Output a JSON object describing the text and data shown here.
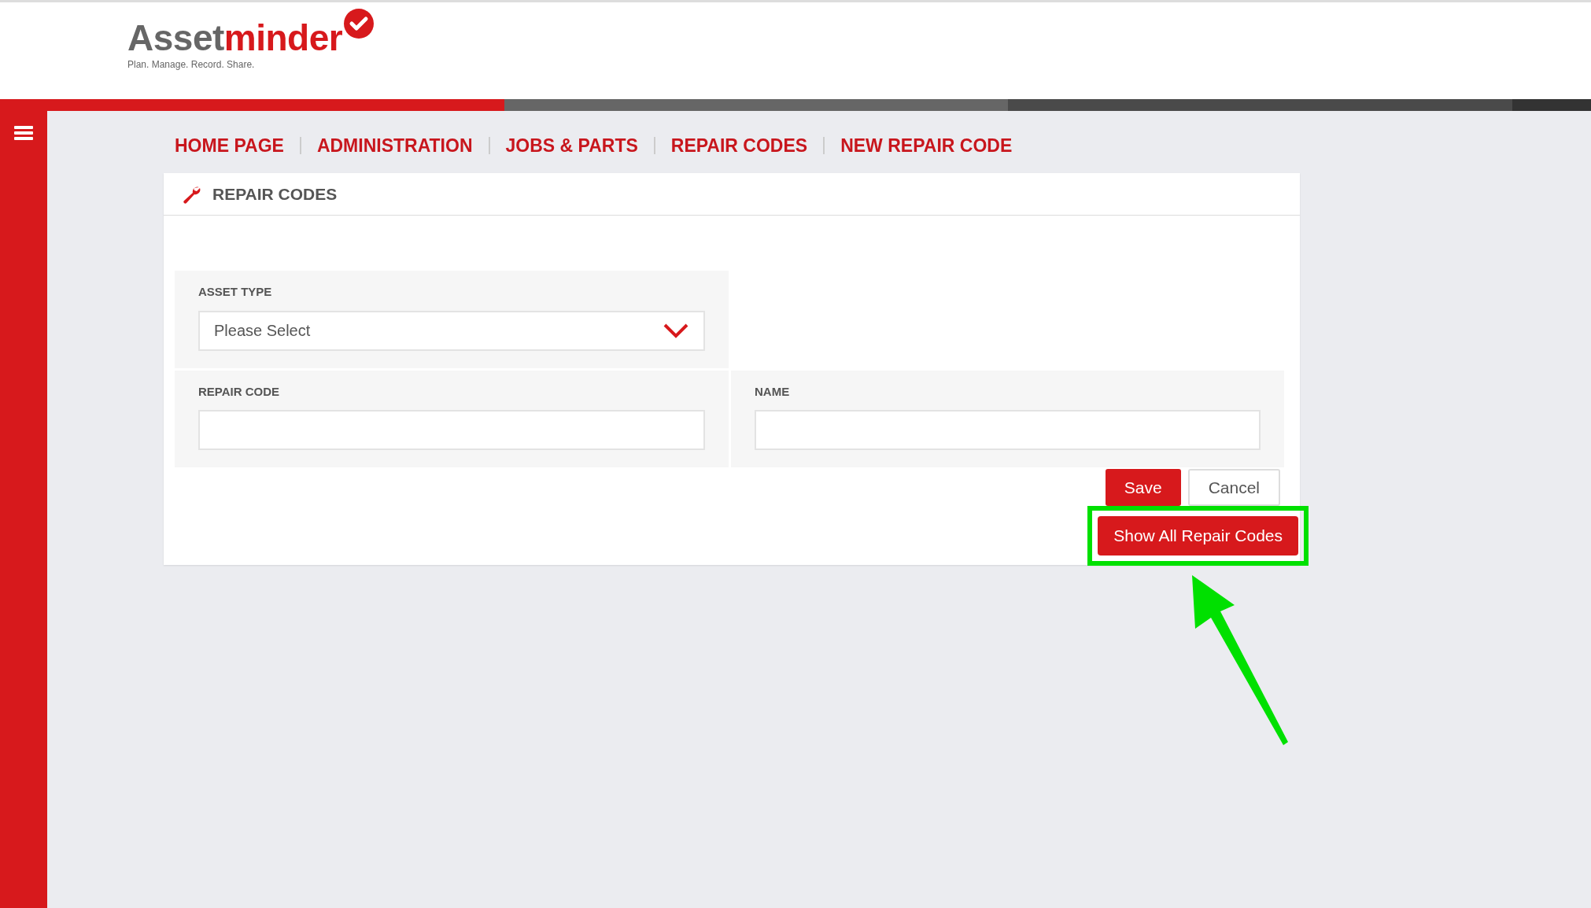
{
  "brand": {
    "main": "Asset",
    "accent": "minder",
    "tagline": "Plan. Manage. Record. Share."
  },
  "breadcrumb": [
    {
      "label": "HOME PAGE"
    },
    {
      "label": "ADMINISTRATION"
    },
    {
      "label": "JOBS & PARTS"
    },
    {
      "label": "REPAIR CODES"
    },
    {
      "label": "NEW REPAIR CODE"
    }
  ],
  "card": {
    "title": "REPAIR CODES",
    "rows": [
      [
        {
          "label": "ASSET TYPE",
          "kind": "select",
          "value": "Please Select"
        }
      ],
      [
        {
          "label": "REPAIR CODE",
          "kind": "text"
        },
        {
          "label": "NAME",
          "kind": "text"
        }
      ]
    ],
    "buttons": [
      {
        "label": "Save",
        "kind": "primary"
      },
      {
        "label": "Cancel",
        "kind": "secondary"
      }
    ],
    "show_all_button": {
      "label": "Show All Repair Codes",
      "highlighted": true
    }
  }
}
